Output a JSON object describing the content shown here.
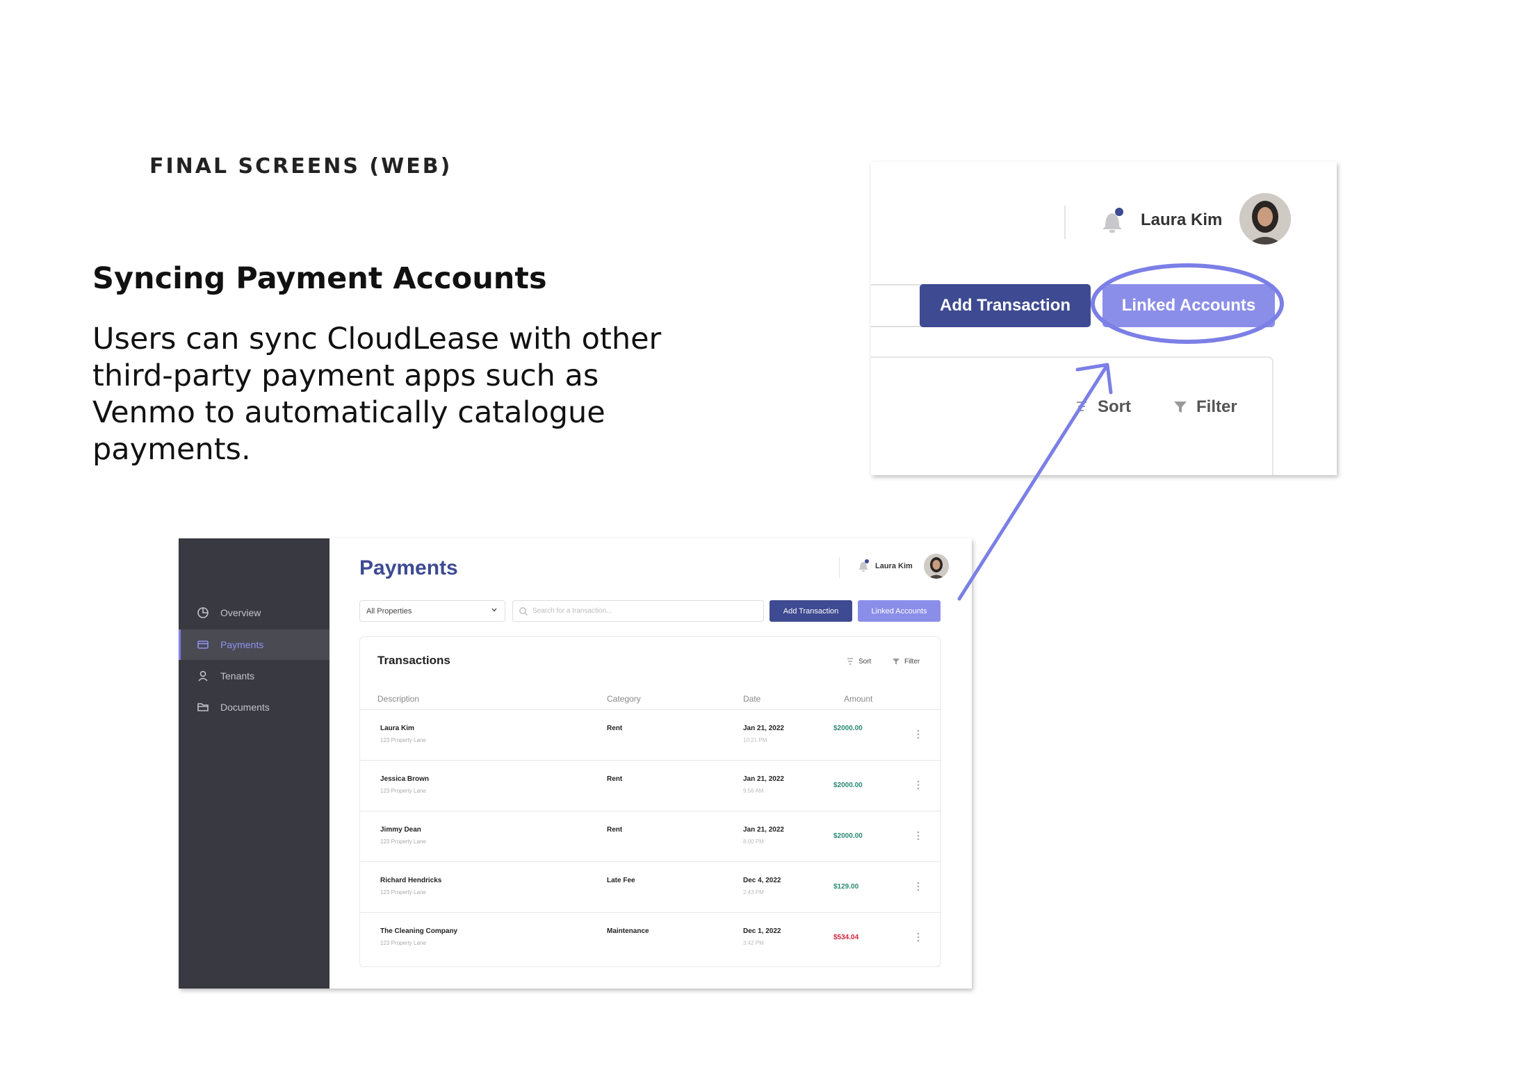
{
  "section_label": "FINAL SCREENS (WEB)",
  "heading": "Syncing Payment Accounts",
  "body_text": "Users can sync CloudLease with other third-party payment apps such as Venmo to automatically catalogue payments.",
  "colors": {
    "primary": "#3e4a91",
    "accent": "#8b8ee8",
    "sidebar": "#393941",
    "positive_amount": "#2a8a73",
    "negative_amount": "#d0223a",
    "highlight_circle": "#7b7fe6"
  },
  "zoom": {
    "user_name": "Laura Kim",
    "add_transaction_label": "Add Transaction",
    "linked_accounts_label": "Linked Accounts",
    "sort_label": "Sort",
    "filter_label": "Filter"
  },
  "app": {
    "sidebar": {
      "items": [
        {
          "label": "Overview",
          "icon": "chart-pie-icon"
        },
        {
          "label": "Payments",
          "icon": "credit-card-icon",
          "active": true
        },
        {
          "label": "Tenants",
          "icon": "user-icon"
        },
        {
          "label": "Documents",
          "icon": "folder-icon"
        }
      ]
    },
    "page_title": "Payments",
    "user_name": "Laura Kim",
    "property_select": "All Properties",
    "search_placeholder": "Search for a transaction...",
    "add_transaction_label": "Add Transaction",
    "linked_accounts_label": "Linked Accounts",
    "transactions": {
      "title": "Transactions",
      "sort_label": "Sort",
      "filter_label": "Filter",
      "columns": [
        "Description",
        "Category",
        "Date",
        "Amount"
      ],
      "rows": [
        {
          "name": "Laura Kim",
          "address": "123 Property Lane",
          "category": "Rent",
          "date": "Jan 21, 2022",
          "time": "10:21 PM",
          "amount": "$2000.00",
          "negative": false
        },
        {
          "name": "Jessica Brown",
          "address": "123 Property Lane",
          "category": "Rent",
          "date": "Jan 21, 2022",
          "time": "9:56 AM",
          "amount": "$2000.00",
          "negative": false
        },
        {
          "name": "Jimmy Dean",
          "address": "123 Property Lane",
          "category": "Rent",
          "date": "Jan 21, 2022",
          "time": "8:00 PM",
          "amount": "$2000.00",
          "negative": false
        },
        {
          "name": "Richard Hendricks",
          "address": "123 Property Lane",
          "category": "Late Fee",
          "date": "Dec 4, 2022",
          "time": "2:43 PM",
          "amount": "$129.00",
          "negative": false
        },
        {
          "name": "The Cleaning Company",
          "address": "123 Property Lane",
          "category": "Maintenance",
          "date": "Dec 1, 2022",
          "time": "3:42 PM",
          "amount": "$534.04",
          "negative": true
        }
      ]
    }
  }
}
